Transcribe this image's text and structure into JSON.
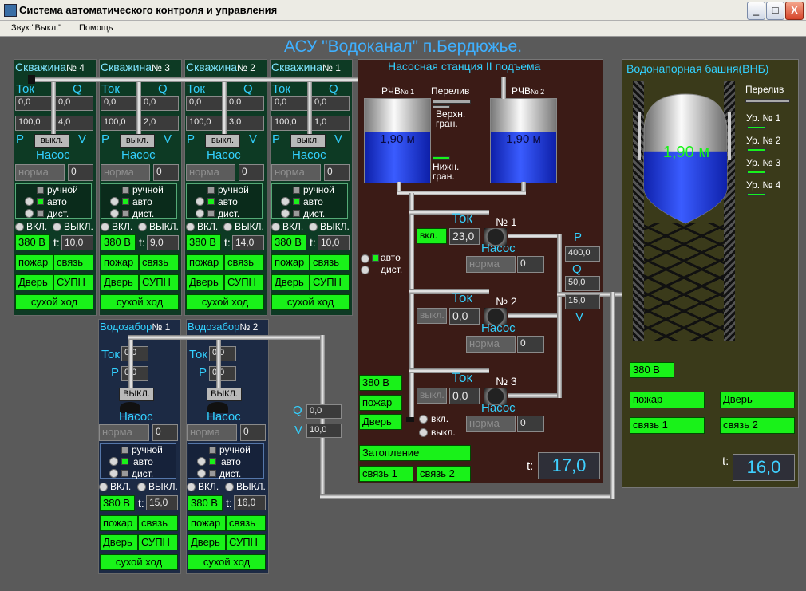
{
  "window": {
    "title": "Система автоматического контроля и управления",
    "buttons": [
      "_",
      "□",
      "X"
    ]
  },
  "menu": {
    "items": [
      "Звук:\"Выкл.\"",
      "Помощь"
    ]
  },
  "main_title": "АСУ \"Водоканал\" п.Бердюжье.",
  "labels": {
    "tok": "Ток",
    "q": "Q",
    "p": "P",
    "v": "V",
    "t": "t:",
    "nasos": "Насос",
    "manual": "ручной",
    "auto": "авто",
    "dist": "дист.",
    "on": "ВКЛ.",
    "off": "ВЫКЛ.",
    "on_lower": "вкл.",
    "off_lower": "выкл.",
    "btn_off": "выкл.",
    "btn_off_caps": "ВЫКЛ.",
    "fire": "пожар",
    "link": "связь",
    "door": "Дверь",
    "supn": "СУПН",
    "dry_run": "сухой ход",
    "v380": "380 В",
    "norma": "норма"
  },
  "wells": [
    {
      "name": "Скважина",
      "num": "№ 4",
      "tok": "0,0",
      "q": "0,0",
      "p": "100,0",
      "v": "4,0",
      "norma_val": "0",
      "temp": "10,0"
    },
    {
      "name": "Скважина",
      "num": "№ 3",
      "tok": "0,0",
      "q": "0,0",
      "p": "100,0",
      "v": "2,0",
      "norma_val": "0",
      "temp": "9,0"
    },
    {
      "name": "Скважина",
      "num": "№ 2",
      "tok": "0,0",
      "q": "0,0",
      "p": "100,0",
      "v": "3,0",
      "norma_val": "0",
      "temp": "14,0"
    },
    {
      "name": "Скважина",
      "num": "№ 1",
      "tok": "0,0",
      "q": "0,0",
      "p": "100,0",
      "v": "1,0",
      "norma_val": "0",
      "temp": "10,0"
    }
  ],
  "intakes": [
    {
      "name": "Водозабор",
      "num": "№ 1",
      "tok": "0,0",
      "p": "0,0",
      "norma_val": "0",
      "temp": "15,0"
    },
    {
      "name": "Водозабор",
      "num": "№ 2",
      "tok": "0,0",
      "p": "0,0",
      "norma_val": "0",
      "temp": "16,0"
    }
  ],
  "intake_flow": {
    "q_label": "Q",
    "v_label": "V",
    "q": "0,0",
    "v": "10,0"
  },
  "station": {
    "title": "Насосная станция II подъема",
    "rchv1": {
      "label": "РЧВ",
      "num": "№ 1",
      "level": "1,90 м",
      "level_fraction": 0.6
    },
    "rchv2": {
      "label": "РЧВ",
      "num": "№ 2",
      "level": "1,90 м",
      "level_fraction": 0.6
    },
    "overflow": "Перелив",
    "upper": "Верхн. гран.",
    "lower": "Нижн. гран.",
    "mode_auto": "авто",
    "mode_dist": "дист.",
    "pumps": [
      {
        "num": "№ 1",
        "tok": "23,0",
        "state": "вкл.",
        "norma_val": "0"
      },
      {
        "num": "№ 2",
        "tok": "0,0",
        "state": "выкл.",
        "norma_val": "0"
      },
      {
        "num": "№ 3",
        "tok": "0,0",
        "state": "выкл.",
        "norma_val": "0"
      }
    ],
    "p_label": "P",
    "q_label": "Q",
    "v_label": "V",
    "p": "400,0",
    "q": "50,0",
    "v": "15,0",
    "v380": "380 В",
    "fire": "пожар",
    "door": "Дверь",
    "flood": "Затопление",
    "link1": "связь 1",
    "link2": "связь 2",
    "temp_label": "t:",
    "temp": "17,0"
  },
  "tower": {
    "title": "Водонапорная башня(ВНБ)",
    "overflow": "Перелив",
    "levels": [
      "Ур. № 1",
      "Ур. № 2",
      "Ур. № 3",
      "Ур. № 4"
    ],
    "level": "1,90 м",
    "level_fraction": 0.55,
    "v380": "380 В",
    "fire": "пожар",
    "door": "Дверь",
    "link1": "связь 1",
    "link2": "связь 2",
    "temp_label": "t:",
    "temp": "16,0"
  },
  "colors": {
    "background": "#5a5a5a",
    "accent": "#33d1ff",
    "status_green": "#19f219",
    "well_bg": "#0d3a24",
    "station_bg": "#3b1b16",
    "intake_bg": "#1c2a44",
    "water": "#2040ff"
  }
}
